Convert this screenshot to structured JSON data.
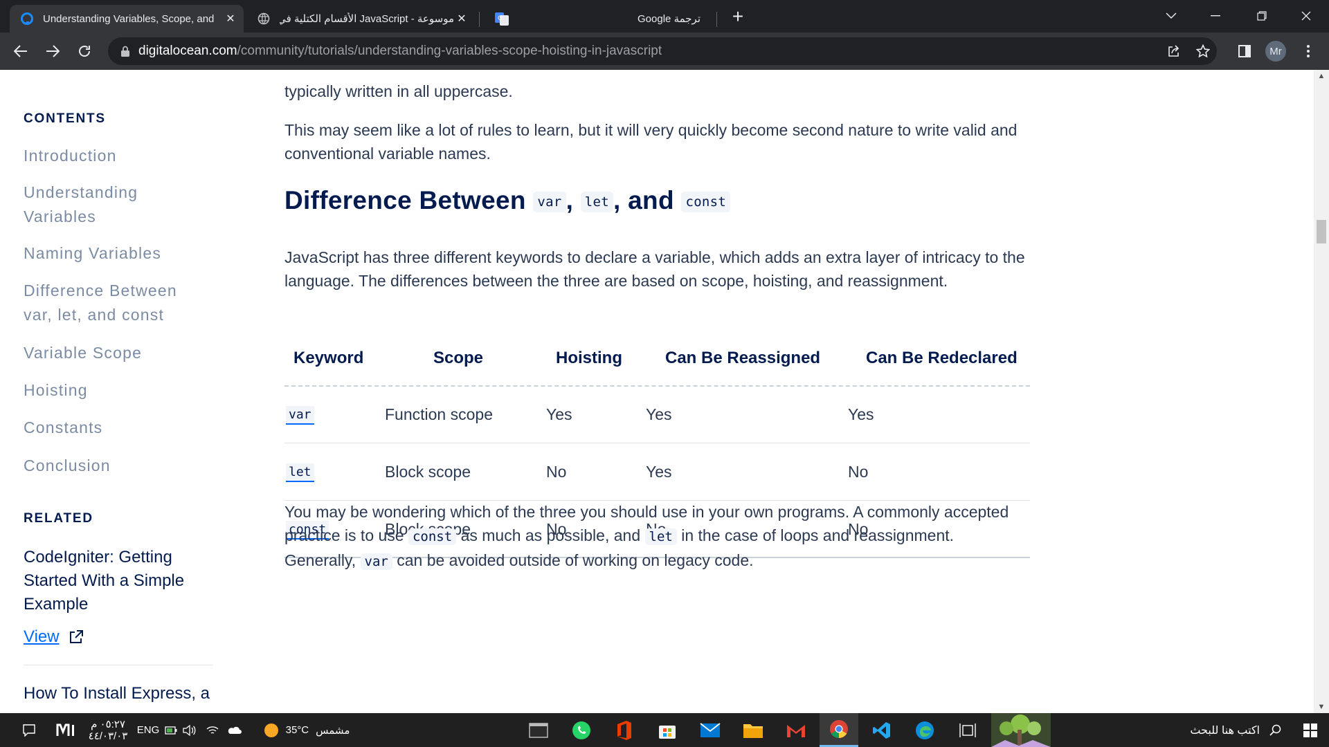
{
  "browser": {
    "tabs": [
      {
        "title": "Understanding Variables, Scope, and",
        "active": true
      },
      {
        "title": "موسوعة - JavaScript الأقسام الكتلية في"
      },
      {
        "title": "Google ترجمة"
      }
    ],
    "url_host": "digitalocean.com",
    "url_path": "/community/tutorials/understanding-variables-scope-hoisting-in-javascript",
    "profile_initials": "Mr"
  },
  "sidebar": {
    "contents_heading": "CONTENTS",
    "toc": [
      "Introduction",
      "Understanding Variables",
      "Naming Variables",
      "Difference Between var, let, and const",
      "Variable Scope",
      "Hoisting",
      "Constants",
      "Conclusion"
    ],
    "related_heading": "RELATED",
    "related": [
      {
        "title": "CodeIgniter: Getting Started With a Simple Example",
        "link": "View"
      },
      {
        "title": "How To Install Express, a"
      }
    ]
  },
  "article": {
    "p_top": "typically written in all uppercase.",
    "p_rules": "This may seem like a lot of rules to learn, but it will very quickly become second nature to write valid and conventional variable names.",
    "heading": {
      "text": "Difference Between",
      "kw1": "var",
      "sep1": ",",
      "kw2": "let",
      "sep2": ", and",
      "kw3": "const"
    },
    "p_intro": "JavaScript has three different keywords to declare a variable, which adds an extra layer of intricacy to the language. The differences between the three are based on scope, hoisting, and reassignment.",
    "table": {
      "headers": [
        "Keyword",
        "Scope",
        "Hoisting",
        "Can Be Reassigned",
        "Can Be Redeclared"
      ],
      "rows": [
        [
          "var",
          "Function scope",
          "Yes",
          "Yes",
          "Yes"
        ],
        [
          "let",
          "Block scope",
          "No",
          "Yes",
          "No"
        ],
        [
          "const",
          "Block scope",
          "No",
          "No",
          "No"
        ]
      ]
    },
    "p_outro": {
      "t1": "You may be wondering which of the three you should use in your own programs. A commonly accepted practice is to use",
      "c1": "const",
      "t2": "as much as possible, and",
      "c2": "let",
      "t3": "in the case of loops and reassignment. Generally,",
      "c3": "var",
      "t4": "can be avoided outside of working on legacy code."
    }
  },
  "taskbar": {
    "time": "٠٥:٢٧ م",
    "date": "٤٤/٠٣/٠٣",
    "language": "ENG",
    "temperature": "35°C",
    "weather_label": "مشمس",
    "search_placeholder": "اكتب هنا للبحث"
  },
  "colors": {
    "accent": "#0069ff",
    "heading": "#031b4e",
    "toc": "#7a8ba3"
  }
}
